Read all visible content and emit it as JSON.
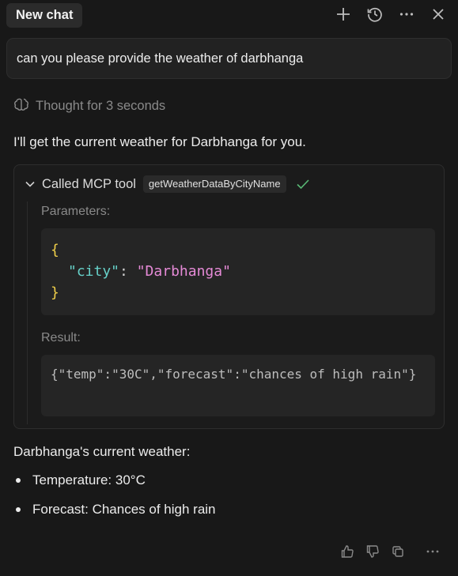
{
  "header": {
    "active_tab": "New chat",
    "actions": [
      {
        "name": "new-chat",
        "icon": "plus-icon"
      },
      {
        "name": "history",
        "icon": "history-icon"
      },
      {
        "name": "more",
        "icon": "ellipsis-icon"
      },
      {
        "name": "close",
        "icon": "close-icon"
      }
    ]
  },
  "conversation": {
    "user_message": "can you please provide the weather of darbhanga",
    "thought": "Thought for 3 seconds",
    "assistant_intro": "I'll get the current weather for Darbhanga for you.",
    "tool_call": {
      "label": "Called MCP tool",
      "tool_name": "getWeatherDataByCityName",
      "status": "success",
      "parameters_label": "Parameters:",
      "parameters": {
        "open": "{",
        "key": "\"city\"",
        "colon": ": ",
        "value": "\"Darbhanga\"",
        "close": "}"
      },
      "result_label": "Result:",
      "result": "{\"temp\":\"30C\",\"forecast\":\"chances of high rain\"}"
    },
    "summary_title": "Darbhanga's current weather:",
    "bullets": [
      "Temperature: 30°C",
      "Forecast: Chances of high rain"
    ]
  },
  "feedback": {
    "actions": [
      "thumbs-up-icon",
      "thumbs-down-icon",
      "copy-icon",
      "ellipsis-icon"
    ]
  },
  "colors": {
    "background": "#181818",
    "panel": "#222222",
    "code_bg": "#252525",
    "json_brace": "#f0cf4a",
    "json_key": "#66d0c8",
    "json_string": "#e58ad6",
    "success": "#58b774",
    "muted": "#8a8a8a"
  }
}
